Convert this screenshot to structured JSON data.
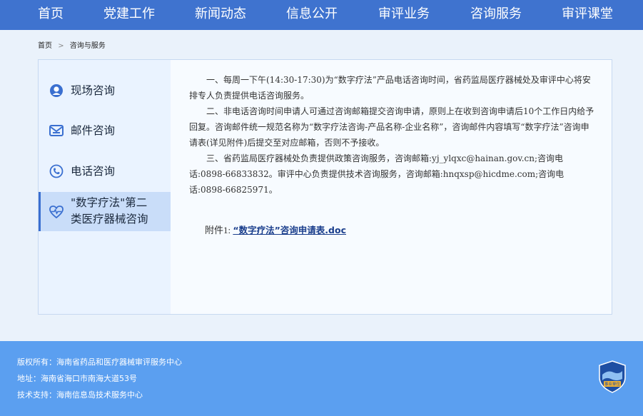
{
  "nav": {
    "items": [
      "首页",
      "党建工作",
      "新闻动态",
      "信息公开",
      "审评业务",
      "咨询服务",
      "审评课堂"
    ]
  },
  "breadcrumb": {
    "home": "首页",
    "sep": ">",
    "current": "咨询与服务"
  },
  "sidebar": {
    "items": [
      {
        "label": "现场咨询",
        "icon": "person-icon"
      },
      {
        "label": "邮件咨询",
        "icon": "mail-icon"
      },
      {
        "label": "电话咨询",
        "icon": "phone-icon"
      },
      {
        "label_line1": "\"数字疗法\"第二",
        "label_line2": "类医疗器械咨询",
        "icon": "heart-pulse-icon",
        "active": true
      }
    ]
  },
  "content": {
    "p1": "一、每周一下午(14:30-17:30)为“数字疗法”产品电话咨询时间，省药监局医疗器械处及审评中心将安排专人负责提供电话咨询服务。",
    "p2": "二、非电话咨询时间申请人可通过咨询邮箱提交咨询申请，原则上在收到咨询申请后10个工作日内给予回复。咨询邮件统一规范名称为“数字疗法咨询-产品名称-企业名称”，咨询邮件内容填写“数字疗法”咨询申请表(详见附件)后提交至对应邮箱，否则不予接收。",
    "p3": "三、省药监局医疗器械处负责提供政策咨询服务，咨询邮箱:yj_ylqxc@hainan.gov.cn;咨询电话:0898-66833832。审评中心负责提供技术咨询服务，咨询邮箱:hnqxsp@hicdme.com;咨询电话:0898-66825971。",
    "attachment_prefix": "附件1:",
    "attachment_link": "“数字疗法”咨询申请表.doc"
  },
  "footer": {
    "copyright": "版权所有：海南省药品和医疗器械审评服务中心",
    "address": "地址：海南省海口市南海大道53号",
    "support": "技术支持：海南信息岛技术服务中心",
    "badge_text": "事业单位"
  },
  "colors": {
    "nav_bg": "#3f73cf",
    "footer_bg": "#5b9ff0",
    "active_bg": "#c9ddf9",
    "link": "#1a3e8c"
  }
}
